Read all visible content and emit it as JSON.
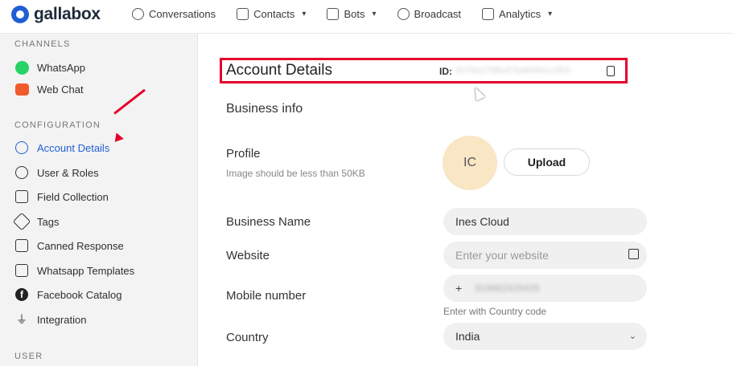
{
  "app": {
    "name": "gallabox"
  },
  "nav": [
    {
      "label": "Conversations",
      "chevron": false
    },
    {
      "label": "Contacts",
      "chevron": true
    },
    {
      "label": "Bots",
      "chevron": true
    },
    {
      "label": "Broadcast",
      "chevron": false
    },
    {
      "label": "Analytics",
      "chevron": true
    }
  ],
  "sidebar": {
    "channels_title": "CHANNELS",
    "channels": [
      {
        "label": "WhatsApp"
      },
      {
        "label": "Web Chat"
      }
    ],
    "configuration_title": "CONFIGURATION",
    "configuration": [
      {
        "label": "Account Details",
        "active": true
      },
      {
        "label": "User & Roles"
      },
      {
        "label": "Field Collection"
      },
      {
        "label": "Tags"
      },
      {
        "label": "Canned Response"
      },
      {
        "label": "Whatsapp Templates"
      },
      {
        "label": "Facebook Catalog"
      },
      {
        "label": "Integration"
      }
    ],
    "user_title": "USER"
  },
  "main": {
    "title": "Account Details",
    "id_label": "ID:",
    "id_value": "627be2798cd7ba6084cc1f03",
    "business_info": "Business info",
    "profile_label": "Profile",
    "profile_hint": "Image should be less than 50KB",
    "avatar_initials": "IC",
    "upload_label": "Upload",
    "business_name_label": "Business Name",
    "business_name_value": "Ines Cloud",
    "website_label": "Website",
    "website_placeholder": "Enter your website",
    "mobile_label": "Mobile number",
    "mobile_prefix": "+",
    "mobile_value": "919962425426",
    "mobile_hint": "Enter with Country code",
    "country_label": "Country",
    "country_value": "India"
  },
  "colors": {
    "accent": "#1f5fd6",
    "highlight": "#e4002b",
    "avatar_bg": "#f8e6c5"
  }
}
